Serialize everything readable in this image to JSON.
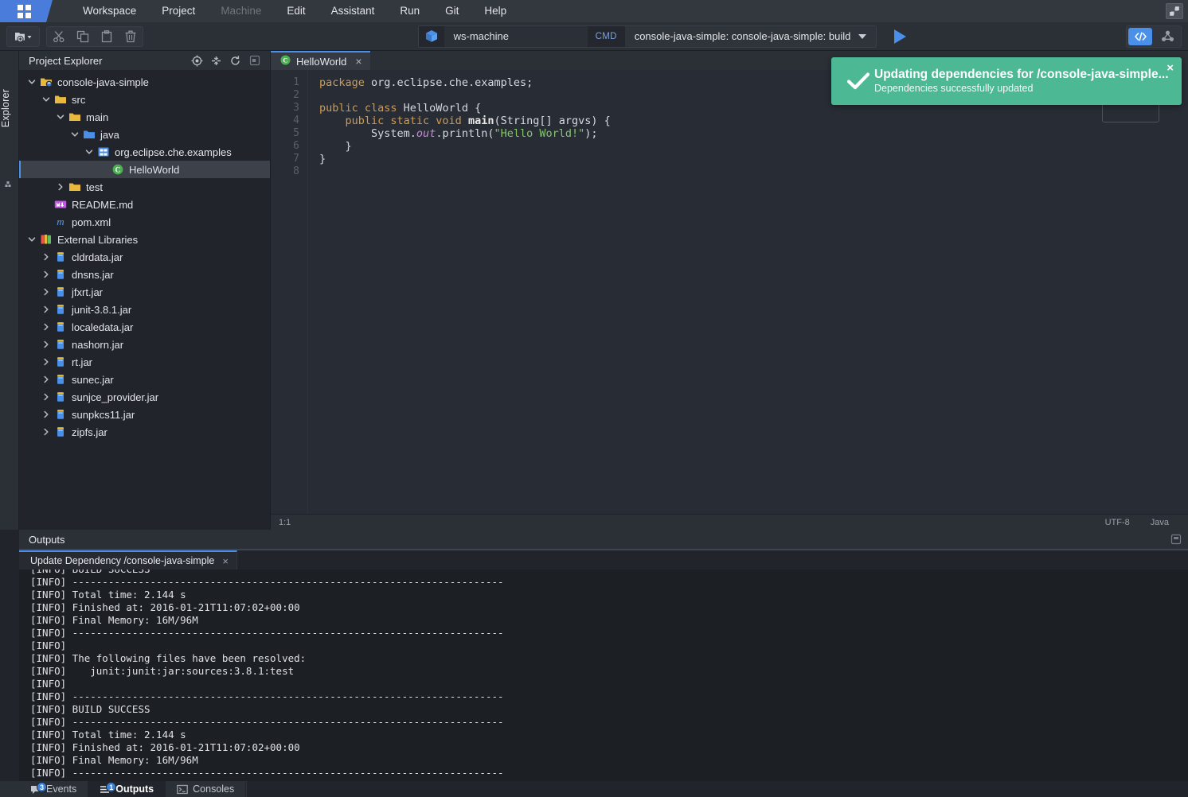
{
  "menubar": {
    "logo": "che-logo",
    "items": [
      {
        "label": "Workspace",
        "disabled": false
      },
      {
        "label": "Project",
        "disabled": false
      },
      {
        "label": "Machine",
        "disabled": true
      },
      {
        "label": "Edit",
        "disabled": false
      },
      {
        "label": "Assistant",
        "disabled": false
      },
      {
        "label": "Run",
        "disabled": false
      },
      {
        "label": "Git",
        "disabled": false
      },
      {
        "label": "Help",
        "disabled": false
      }
    ],
    "maximize_icon": "maximize-icon"
  },
  "toolbar": {
    "new_icon": "new-file-icon",
    "cut_icon": "scissors-icon",
    "copy_icon": "copy-icon",
    "paste_icon": "paste-icon",
    "delete_icon": "trash-icon",
    "machine_icon": "cube-icon",
    "machine_name": "ws-machine",
    "cmd_label": "CMD",
    "command": "console-java-simple: console-java-simple: build",
    "run_icon": "play-icon",
    "code_view_icon": "code-brackets-icon",
    "preview_icon": "molecule-icon"
  },
  "left_rail": {
    "tab_label": "Explorer",
    "panel_icon": "panel-toggle-icon"
  },
  "explorer": {
    "title": "Project Explorer",
    "actions": [
      {
        "name": "locate-icon"
      },
      {
        "name": "collapse-all-icon"
      },
      {
        "name": "refresh-icon"
      },
      {
        "name": "minimize-panel-icon"
      }
    ],
    "tree": [
      {
        "label": "console-java-simple",
        "depth": 0,
        "twisty": "down",
        "icon": "project-folder-icon",
        "selected": false
      },
      {
        "label": "src",
        "depth": 1,
        "twisty": "down",
        "icon": "folder-icon",
        "selected": false
      },
      {
        "label": "main",
        "depth": 2,
        "twisty": "down",
        "icon": "folder-icon",
        "selected": false
      },
      {
        "label": "java",
        "depth": 3,
        "twisty": "down",
        "icon": "source-folder-icon",
        "selected": false
      },
      {
        "label": "org.eclipse.che.examples",
        "depth": 4,
        "twisty": "down",
        "icon": "package-icon",
        "selected": false
      },
      {
        "label": "HelloWorld",
        "depth": 5,
        "twisty": "none",
        "icon": "java-class-icon",
        "selected": true
      },
      {
        "label": "test",
        "depth": 2,
        "twisty": "right",
        "icon": "folder-icon",
        "selected": false
      },
      {
        "label": "README.md",
        "depth": 1,
        "twisty": "none",
        "icon": "markdown-icon",
        "selected": false
      },
      {
        "label": "pom.xml",
        "depth": 1,
        "twisty": "none",
        "icon": "maven-icon",
        "selected": false
      },
      {
        "label": "External Libraries",
        "depth": 0,
        "twisty": "down",
        "icon": "libraries-icon",
        "selected": false
      },
      {
        "label": "cldrdata.jar",
        "depth": 1,
        "twisty": "right",
        "icon": "jar-icon",
        "selected": false
      },
      {
        "label": "dnsns.jar",
        "depth": 1,
        "twisty": "right",
        "icon": "jar-icon",
        "selected": false
      },
      {
        "label": "jfxrt.jar",
        "depth": 1,
        "twisty": "right",
        "icon": "jar-icon",
        "selected": false
      },
      {
        "label": "junit-3.8.1.jar",
        "depth": 1,
        "twisty": "right",
        "icon": "jar-icon",
        "selected": false
      },
      {
        "label": "localedata.jar",
        "depth": 1,
        "twisty": "right",
        "icon": "jar-icon",
        "selected": false
      },
      {
        "label": "nashorn.jar",
        "depth": 1,
        "twisty": "right",
        "icon": "jar-icon",
        "selected": false
      },
      {
        "label": "rt.jar",
        "depth": 1,
        "twisty": "right",
        "icon": "jar-icon",
        "selected": false
      },
      {
        "label": "sunec.jar",
        "depth": 1,
        "twisty": "right",
        "icon": "jar-icon",
        "selected": false
      },
      {
        "label": "sunjce_provider.jar",
        "depth": 1,
        "twisty": "right",
        "icon": "jar-icon",
        "selected": false
      },
      {
        "label": "sunpkcs11.jar",
        "depth": 1,
        "twisty": "right",
        "icon": "jar-icon",
        "selected": false
      },
      {
        "label": "zipfs.jar",
        "depth": 1,
        "twisty": "right",
        "icon": "jar-icon",
        "selected": false
      }
    ]
  },
  "editor": {
    "tab": {
      "label": "HelloWorld",
      "icon": "java-class-icon",
      "close": "×"
    },
    "line_numbers": [
      "1",
      "2",
      "3",
      "4",
      "5",
      "6",
      "7",
      "8"
    ],
    "code_lines": [
      [
        {
          "t": "package ",
          "c": "k-key"
        },
        {
          "t": "org.eclipse.che.examples;",
          "c": "k-plain"
        }
      ],
      [],
      [
        {
          "t": "public class ",
          "c": "k-key"
        },
        {
          "t": "HelloWorld {",
          "c": "k-plain"
        }
      ],
      [
        {
          "t": "    public static void ",
          "c": "k-key"
        },
        {
          "t": "main",
          "c": "k-fn"
        },
        {
          "t": "(String[] argvs) {",
          "c": "k-plain"
        }
      ],
      [
        {
          "t": "        System.",
          "c": "k-plain"
        },
        {
          "t": "out",
          "c": "k-fld"
        },
        {
          "t": ".println(",
          "c": "k-plain"
        },
        {
          "t": "\"Hello World!\"",
          "c": "k-str"
        },
        {
          "t": ");",
          "c": "k-plain"
        }
      ],
      [
        {
          "t": "    }",
          "c": "k-plain"
        }
      ],
      [
        {
          "t": "}",
          "c": "k-plain"
        }
      ],
      []
    ],
    "status": {
      "cursor": "1:1",
      "encoding": "UTF-8",
      "language": "Java"
    }
  },
  "outputs": {
    "title": "Outputs",
    "maximize_icon": "maximize-panel-icon",
    "tabs": [
      {
        "label": "Update Dependency /console-java-simple",
        "close": "×",
        "active": true
      }
    ],
    "console_lines": [
      "[INFO] BUILD SUCCESS",
      "[INFO] ------------------------------------------------------------------------",
      "[INFO] Total time: 2.144 s",
      "[INFO] Finished at: 2016-01-21T11:07:02+00:00",
      "[INFO] Final Memory: 16M/96M",
      "[INFO] ------------------------------------------------------------------------",
      "[INFO] ",
      "[INFO] The following files have been resolved:",
      "[INFO]    junit:junit:jar:sources:3.8.1:test",
      "[INFO] ",
      "[INFO] ------------------------------------------------------------------------",
      "[INFO] BUILD SUCCESS",
      "[INFO] ------------------------------------------------------------------------",
      "[INFO] Total time: 2.144 s",
      "[INFO] Finished at: 2016-01-21T11:07:02+00:00",
      "[INFO] Final Memory: 16M/96M",
      "[INFO] ------------------------------------------------------------------------"
    ]
  },
  "bottombar": {
    "tabs": [
      {
        "label": "Events",
        "badge": "3",
        "icon": "events-icon",
        "active": false
      },
      {
        "label": "Outputs",
        "badge": "1",
        "icon": "outputs-icon",
        "active": true
      },
      {
        "label": "Consoles",
        "badge": "",
        "icon": "terminal-icon",
        "active": false
      }
    ]
  },
  "toast": {
    "icon": "check-icon",
    "title": "Updating dependencies for /console-java-simple...",
    "subtitle": "Dependencies successfully updated",
    "close": "×",
    "color": "#4cb894"
  }
}
